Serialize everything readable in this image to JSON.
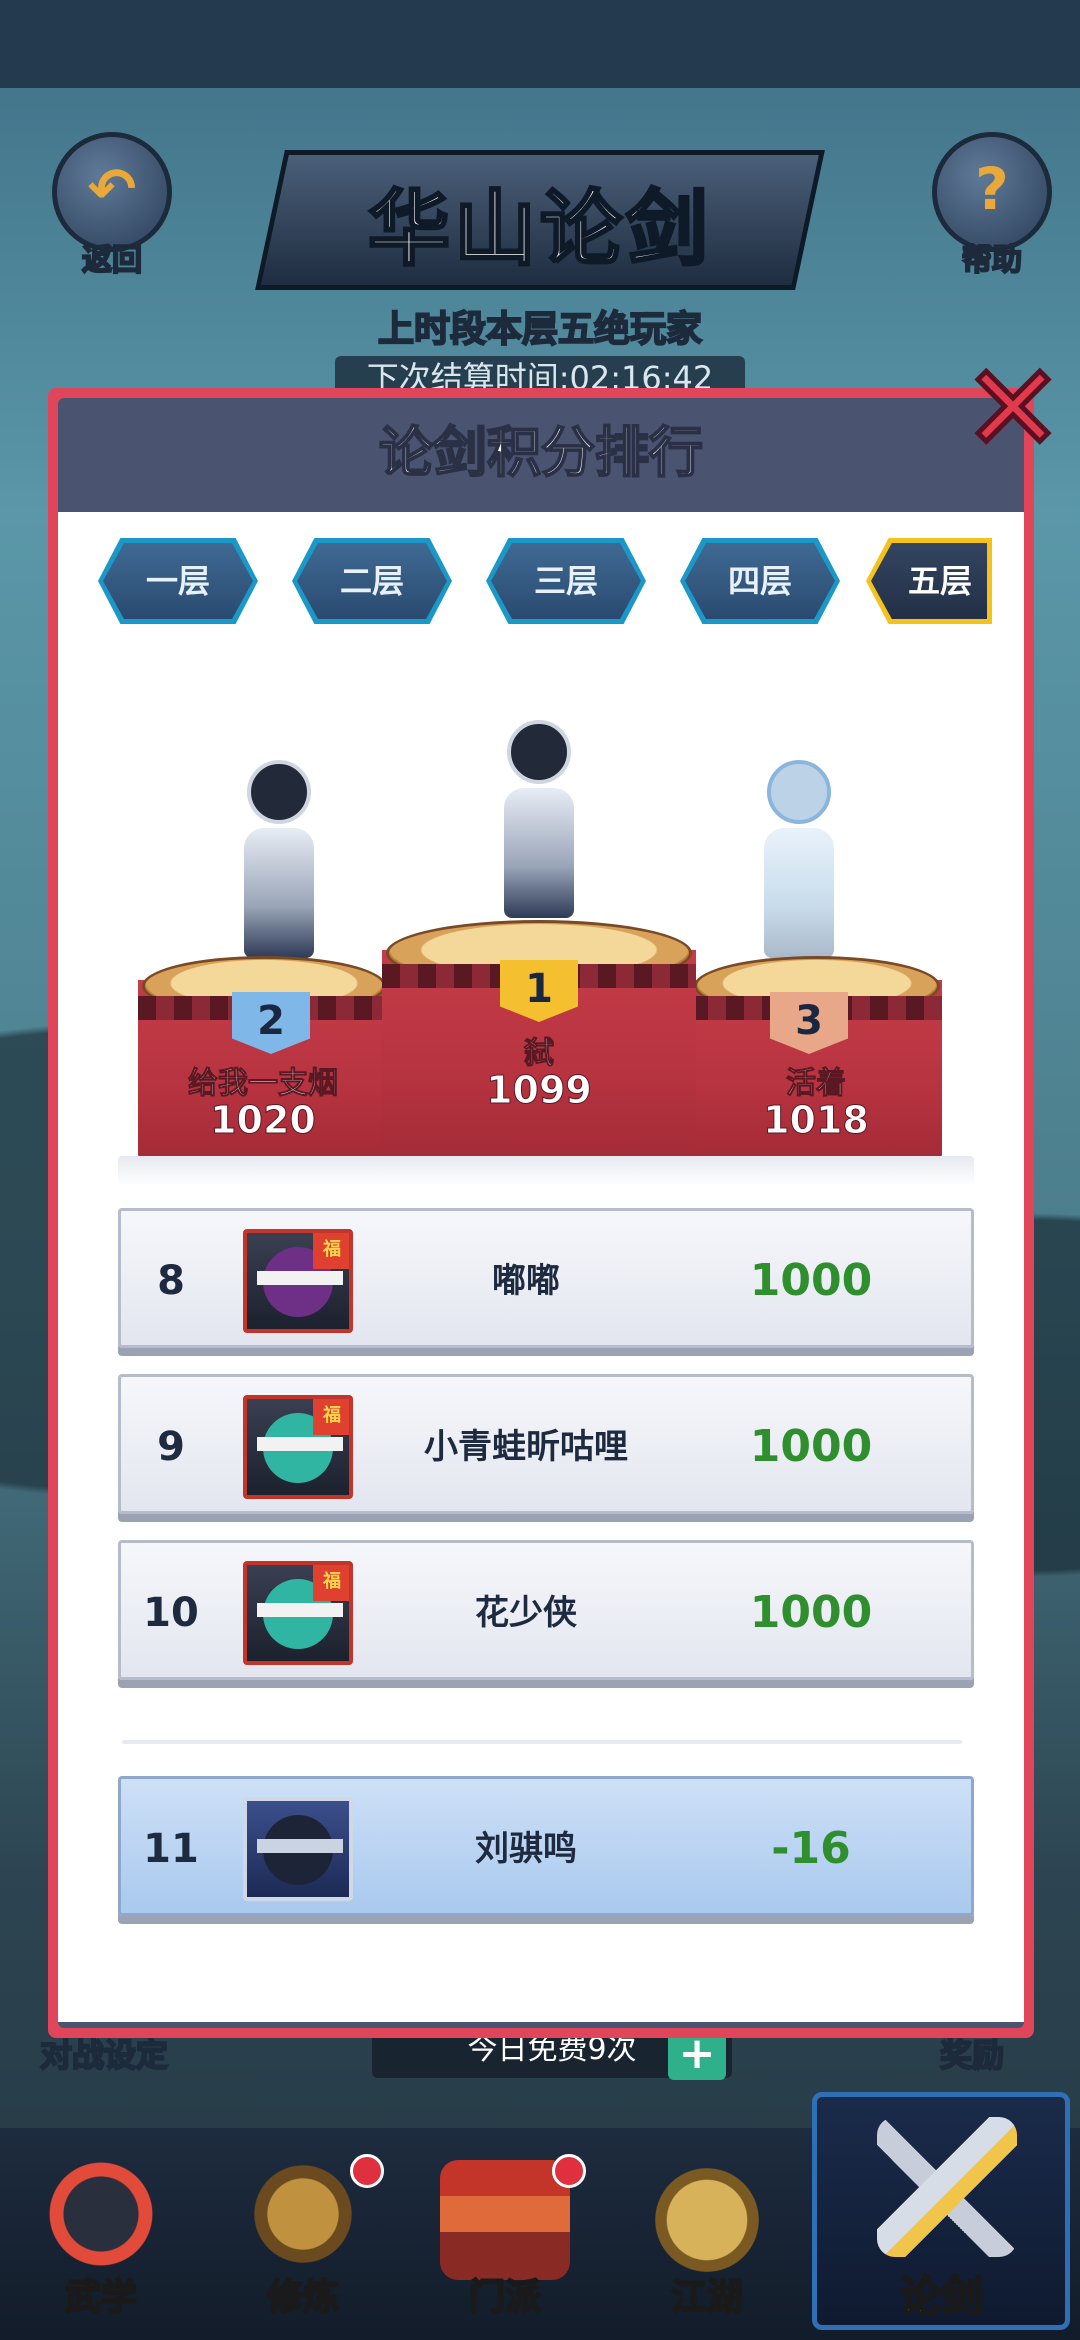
{
  "header": {
    "back_label": "返回",
    "help_label": "帮助",
    "title": "华山论剑",
    "subtitle": "上时段本层五绝玩家",
    "countdown": "下次结算时间:02:16:42"
  },
  "modal": {
    "title": "论剑积分排行",
    "close": "✕",
    "tabs": [
      {
        "label": "一层",
        "active": false
      },
      {
        "label": "二层",
        "active": false
      },
      {
        "label": "三层",
        "active": false
      },
      {
        "label": "四层",
        "active": false
      },
      {
        "label": "五层",
        "active": true
      }
    ],
    "podium": [
      {
        "rank": "2",
        "name": "给我一支烟",
        "score": "1020"
      },
      {
        "rank": "1",
        "name": "弑",
        "score": "1099"
      },
      {
        "rank": "3",
        "name": "活着",
        "score": "1018"
      }
    ],
    "rows": [
      {
        "rank": "8",
        "name": "嘟嘟",
        "score": "1000"
      },
      {
        "rank": "9",
        "name": "小青蛙昕咕哩",
        "score": "1000"
      },
      {
        "rank": "10",
        "name": "花少侠",
        "score": "1000"
      }
    ],
    "self_row": {
      "rank": "11",
      "name": "刘骐鸣",
      "score": "-16"
    }
  },
  "background": {
    "battle_settings": "对战设定",
    "free_today": "今日免费9次",
    "plus": "+",
    "reward": "奖励"
  },
  "nav": {
    "items": [
      {
        "label": "武学"
      },
      {
        "label": "修炼"
      },
      {
        "label": "门派"
      },
      {
        "label": "江湖"
      },
      {
        "label": "论剑"
      }
    ]
  },
  "colors": {
    "accent_gold": "#f4c21a",
    "score_green": "#2f8f2f",
    "modal_border": "#e0455a",
    "podium_red": "#b73340"
  }
}
